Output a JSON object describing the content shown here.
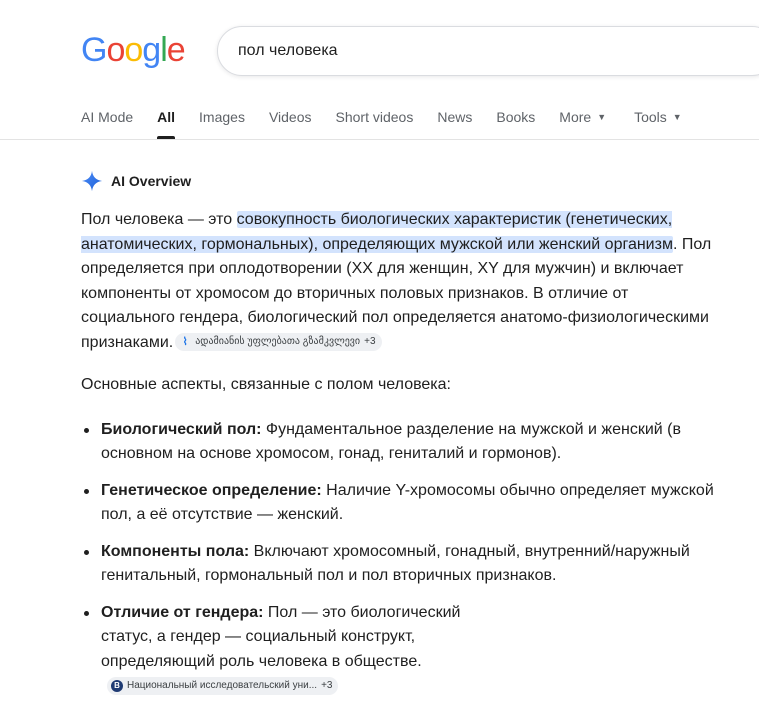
{
  "logo": {
    "letters": [
      "G",
      "o",
      "o",
      "g",
      "l",
      "e"
    ],
    "colors": [
      "#4285f4",
      "#ea4335",
      "#fbbc05",
      "#4285f4",
      "#34a853",
      "#ea4335"
    ]
  },
  "search": {
    "query": "пол человека"
  },
  "tabs": [
    {
      "label": "AI Mode"
    },
    {
      "label": "All",
      "active": true
    },
    {
      "label": "Images"
    },
    {
      "label": "Videos"
    },
    {
      "label": "Short videos"
    },
    {
      "label": "News"
    },
    {
      "label": "Books"
    },
    {
      "label": "More",
      "dropdown": true
    },
    {
      "label": "Tools",
      "dropdown": true
    }
  ],
  "ai_overview": {
    "title": "AI Overview",
    "icon": "sparkle-icon",
    "p1": {
      "pre": "Пол человека — это ",
      "highlight": "совокупность биологических характеристик (генетических, анатомических, гормональных), определяющих мужской или женский организм",
      "post": ". Пол определяется при оплодотворении (XX для женщин, XY для мужчин) и включает компоненты от хромосом до вторичных половых признаков. В отличие от социального гендера, биологический пол определяется анатомо-физиологическими признаками."
    },
    "source_chip_1": {
      "label": "ადამიანის უფლებათა გზამკვლევი",
      "more": "+3",
      "icon": "book-icon"
    },
    "intro": "Основные аспекты, связанные с полом человека:",
    "aspects": [
      {
        "term": "Биологический пол:",
        "text": " Фундаментальное разделение на мужской и женский (в основном на основе хромосом, гонад, гениталий и гормонов)."
      },
      {
        "term": "Генетическое определение:",
        "text": " Наличие Y-хромосомы обычно определяет мужской пол, а её отсутствие — женский."
      },
      {
        "term": "Компоненты пола:",
        "text": " Включают хромосомный, гонадный, внутренний/наружный генитальный, гормональный пол и пол вторичных признаков."
      },
      {
        "term": "Отличие от гендера:",
        "text": " Пол — это биологический статус, а гендер — социальный конструкт, определяющий роль человека в обществе."
      }
    ],
    "source_chip_2": {
      "label": "Национальный исследовательский уни...",
      "more": "+3",
      "icon_letter": "В"
    }
  }
}
